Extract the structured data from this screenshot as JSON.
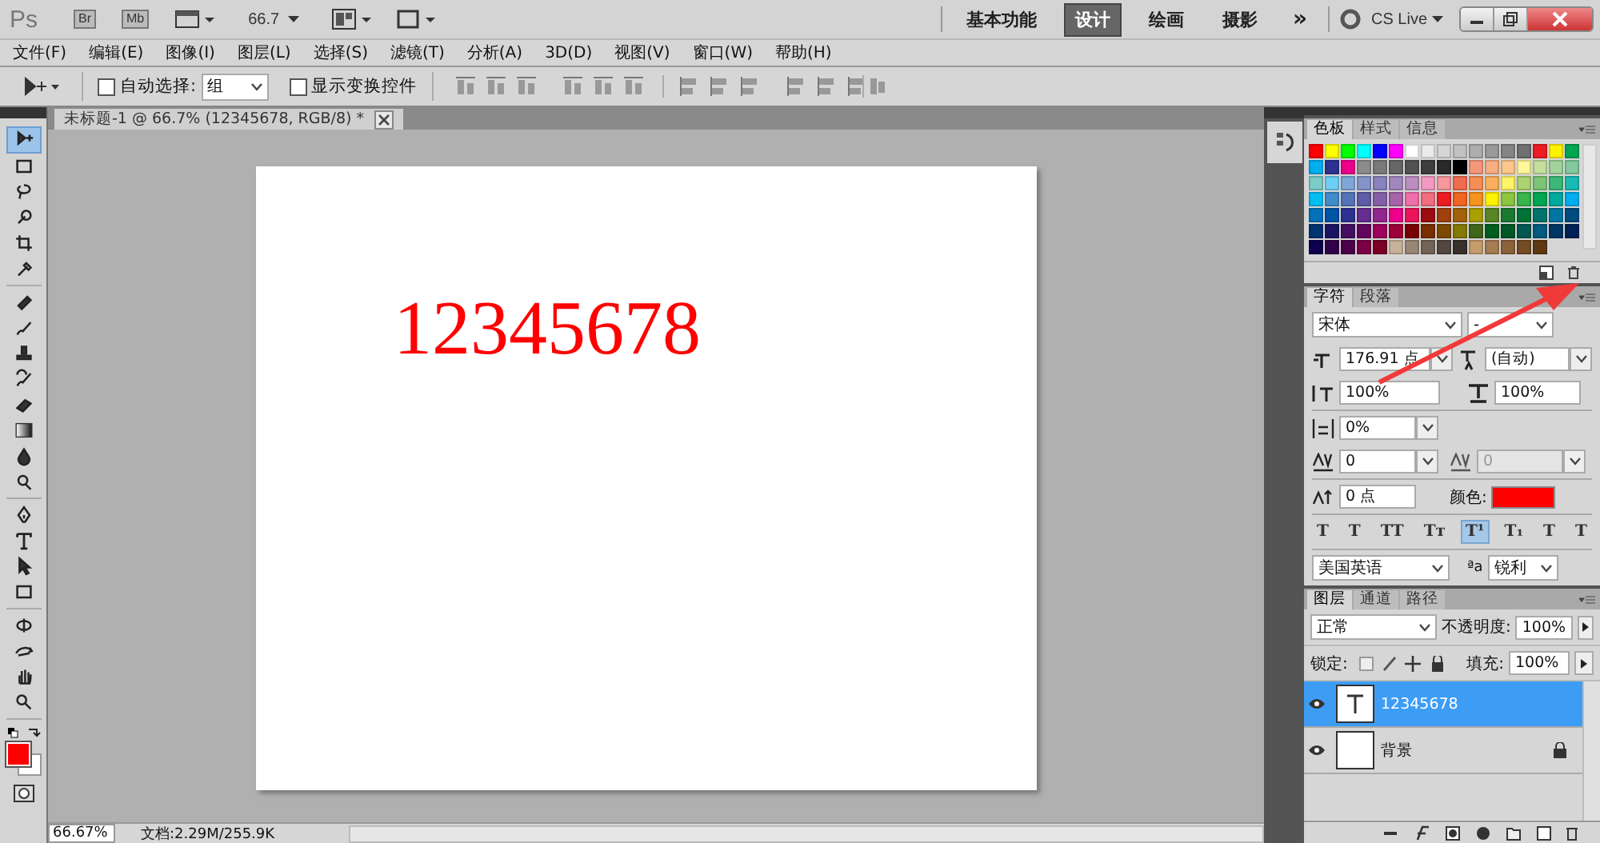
{
  "app_bar": {
    "logo": "Ps",
    "buttons": [
      "Br",
      "Mb"
    ],
    "zoom": "66.7",
    "workspaces": [
      {
        "label": "基本功能",
        "selected": false
      },
      {
        "label": "设计",
        "selected": true
      },
      {
        "label": "绘画",
        "selected": false
      },
      {
        "label": "摄影",
        "selected": false
      }
    ],
    "more": "»",
    "cs_live": "CS Live"
  },
  "menu": [
    "文件(F)",
    "编辑(E)",
    "图像(I)",
    "图层(L)",
    "选择(S)",
    "滤镜(T)",
    "分析(A)",
    "3D(D)",
    "视图(V)",
    "窗口(W)",
    "帮助(H)"
  ],
  "options_bar": {
    "auto_select": {
      "label": "自动选择:",
      "checked": false
    },
    "auto_select_target": "组",
    "show_transform": {
      "label": "显示变换控件",
      "checked": false
    }
  },
  "tools": [
    {
      "kind": "move",
      "selected": true
    },
    {
      "kind": "marquee",
      "selected": false
    },
    {
      "kind": "lasso",
      "selected": false
    },
    {
      "kind": "quick-select",
      "selected": false
    },
    {
      "kind": "crop",
      "selected": false
    },
    {
      "kind": "eyedropper",
      "selected": false
    },
    {
      "kind": "healing",
      "selected": false
    },
    {
      "kind": "brush",
      "selected": false
    },
    {
      "kind": "stamp",
      "selected": false
    },
    {
      "kind": "history-brush",
      "selected": false
    },
    {
      "kind": "eraser",
      "selected": false
    },
    {
      "kind": "gradient",
      "selected": false
    },
    {
      "kind": "blur",
      "selected": false
    },
    {
      "kind": "dodge",
      "selected": false
    },
    {
      "kind": "pen",
      "selected": false
    },
    {
      "kind": "type",
      "selected": false
    },
    {
      "kind": "path-select",
      "selected": false
    },
    {
      "kind": "shape",
      "selected": false
    },
    {
      "kind": "rotate-3d",
      "selected": false
    },
    {
      "kind": "orbit-3d",
      "selected": false
    },
    {
      "kind": "hand",
      "selected": false
    },
    {
      "kind": "zoom",
      "selected": false
    }
  ],
  "document": {
    "tab": "未标题-1 @ 66.7% (12345678, RGB/8) *",
    "text": "12345678"
  },
  "swatches_panel": {
    "tabs": [
      {
        "label": "色板",
        "selected": true
      },
      {
        "label": "样式",
        "selected": false
      },
      {
        "label": "信息",
        "selected": false
      }
    ],
    "swatches": [
      {
        "color": "#ff0000"
      },
      {
        "color": "#ffff00"
      },
      {
        "color": "#00ff00"
      },
      {
        "color": "#00ffff"
      },
      {
        "color": "#0000ff"
      },
      {
        "color": "#ff00ff"
      },
      {
        "color": "#ffffff"
      },
      {
        "color": "#ebebeb"
      },
      {
        "color": "#d6d6d6"
      },
      {
        "color": "#c2c2c2"
      },
      {
        "color": "#adadad"
      },
      {
        "color": "#999999"
      },
      {
        "color": "#858585"
      },
      {
        "color": "#707070"
      },
      {
        "color": "#ed1c24"
      },
      {
        "color": "#fff200"
      },
      {
        "color": "#00a651"
      },
      {
        "color": "#00aeef"
      },
      {
        "color": "#2e3192"
      },
      {
        "color": "#ec008c"
      },
      {
        "color": "#8c8c8c"
      },
      {
        "color": "#7a7a7a"
      },
      {
        "color": "#666666"
      },
      {
        "color": "#525252"
      },
      {
        "color": "#3d3d3d"
      },
      {
        "color": "#292929"
      },
      {
        "color": "#000000"
      },
      {
        "color": "#f7977a"
      },
      {
        "color": "#f9ad81"
      },
      {
        "color": "#fdc68a"
      },
      {
        "color": "#fff79a"
      },
      {
        "color": "#c4df9b"
      },
      {
        "color": "#a2d39c"
      },
      {
        "color": "#82ca9d"
      },
      {
        "color": "#7bcdc8"
      },
      {
        "color": "#6ecff6"
      },
      {
        "color": "#7ea7d8"
      },
      {
        "color": "#8493ca"
      },
      {
        "color": "#8882be"
      },
      {
        "color": "#a187be"
      },
      {
        "color": "#bc8dbf"
      },
      {
        "color": "#f49ac2"
      },
      {
        "color": "#f6989d"
      },
      {
        "color": "#f26c4f"
      },
      {
        "color": "#f68e55"
      },
      {
        "color": "#fbaf5c"
      },
      {
        "color": "#fff467"
      },
      {
        "color": "#acd372"
      },
      {
        "color": "#7cc576"
      },
      {
        "color": "#3bb878"
      },
      {
        "color": "#1abbb4"
      },
      {
        "color": "#00bff3"
      },
      {
        "color": "#438ccb"
      },
      {
        "color": "#5574b9"
      },
      {
        "color": "#605ca8"
      },
      {
        "color": "#855fa8"
      },
      {
        "color": "#a763a8"
      },
      {
        "color": "#f06ea9"
      },
      {
        "color": "#f26d7d"
      },
      {
        "color": "#ed1c24"
      },
      {
        "color": "#f26522"
      },
      {
        "color": "#f7941d"
      },
      {
        "color": "#fff200"
      },
      {
        "color": "#8dc63f"
      },
      {
        "color": "#39b54a"
      },
      {
        "color": "#00a651"
      },
      {
        "color": "#00a99d"
      },
      {
        "color": "#00aeef"
      },
      {
        "color": "#0072bc"
      },
      {
        "color": "#0054a6"
      },
      {
        "color": "#2e3192"
      },
      {
        "color": "#662d91"
      },
      {
        "color": "#92278f"
      },
      {
        "color": "#ec008c"
      },
      {
        "color": "#ed145b"
      },
      {
        "color": "#9e0b0f"
      },
      {
        "color": "#a0410d"
      },
      {
        "color": "#a3620a"
      },
      {
        "color": "#aba000"
      },
      {
        "color": "#598527"
      },
      {
        "color": "#1a7b30"
      },
      {
        "color": "#007236"
      },
      {
        "color": "#00746b"
      },
      {
        "color": "#0076a3"
      },
      {
        "color": "#004b80"
      },
      {
        "color": "#003471"
      },
      {
        "color": "#1b1464"
      },
      {
        "color": "#440e62"
      },
      {
        "color": "#630460"
      },
      {
        "color": "#9e005d"
      },
      {
        "color": "#9e0039"
      },
      {
        "color": "#790000"
      },
      {
        "color": "#7b2e00"
      },
      {
        "color": "#7d4900"
      },
      {
        "color": "#827b00"
      },
      {
        "color": "#406618"
      },
      {
        "color": "#005e20"
      },
      {
        "color": "#005826"
      },
      {
        "color": "#005952"
      },
      {
        "color": "#005b7f"
      },
      {
        "color": "#003663"
      },
      {
        "color": "#002157"
      },
      {
        "color": "#0d004c"
      },
      {
        "color": "#32004b"
      },
      {
        "color": "#4b0049"
      },
      {
        "color": "#7b0046"
      },
      {
        "color": "#7a0026"
      },
      {
        "color": "#c7b299"
      },
      {
        "color": "#998675"
      },
      {
        "color": "#736357"
      },
      {
        "color": "#534741"
      },
      {
        "color": "#37302d"
      },
      {
        "color": "#c69c6d"
      },
      {
        "color": "#a67c52"
      },
      {
        "color": "#8c6239"
      },
      {
        "color": "#754c24"
      },
      {
        "color": "#603913"
      }
    ]
  },
  "character_panel": {
    "tabs": [
      {
        "label": "字符",
        "selected": true
      },
      {
        "label": "段落",
        "selected": false
      }
    ],
    "font": "宋体",
    "style": "-",
    "size": "176.91 点",
    "leading": "(自动)",
    "vertical_scale": "100%",
    "horizontal_scale": "100%",
    "baseline_scale": "0%",
    "kerning": "0",
    "tracking": "0",
    "baseline_shift": "0 点",
    "color_label": "颜色:",
    "styles": [
      {
        "label": "T",
        "selected": false
      },
      {
        "label": "T",
        "selected": false
      },
      {
        "label": "TT",
        "selected": false
      },
      {
        "label": "Tт",
        "selected": false
      },
      {
        "label": "T¹",
        "selected": true
      },
      {
        "label": "T₁",
        "selected": false
      },
      {
        "label": "T",
        "selected": false
      },
      {
        "label": "T",
        "selected": false
      }
    ],
    "language": "美国英语",
    "aa_label": "ªa",
    "antialias": "锐利"
  },
  "layers_panel": {
    "tabs": [
      {
        "label": "图层",
        "selected": true
      },
      {
        "label": "通道",
        "selected": false
      },
      {
        "label": "路径",
        "selected": false
      }
    ],
    "blend_mode": "正常",
    "opacity_label": "不透明度:",
    "opacity": "100%",
    "lock_label": "锁定:",
    "fill_label": "填充:",
    "fill": "100%",
    "layers": [
      {
        "name": "12345678",
        "kind": "text",
        "selected": true,
        "locked": false
      },
      {
        "name": "背景",
        "kind": "image",
        "selected": false,
        "locked": true
      }
    ]
  },
  "status_bar": {
    "zoom": "66.67%",
    "doc_size": "文档:2.29M/255.9K"
  }
}
